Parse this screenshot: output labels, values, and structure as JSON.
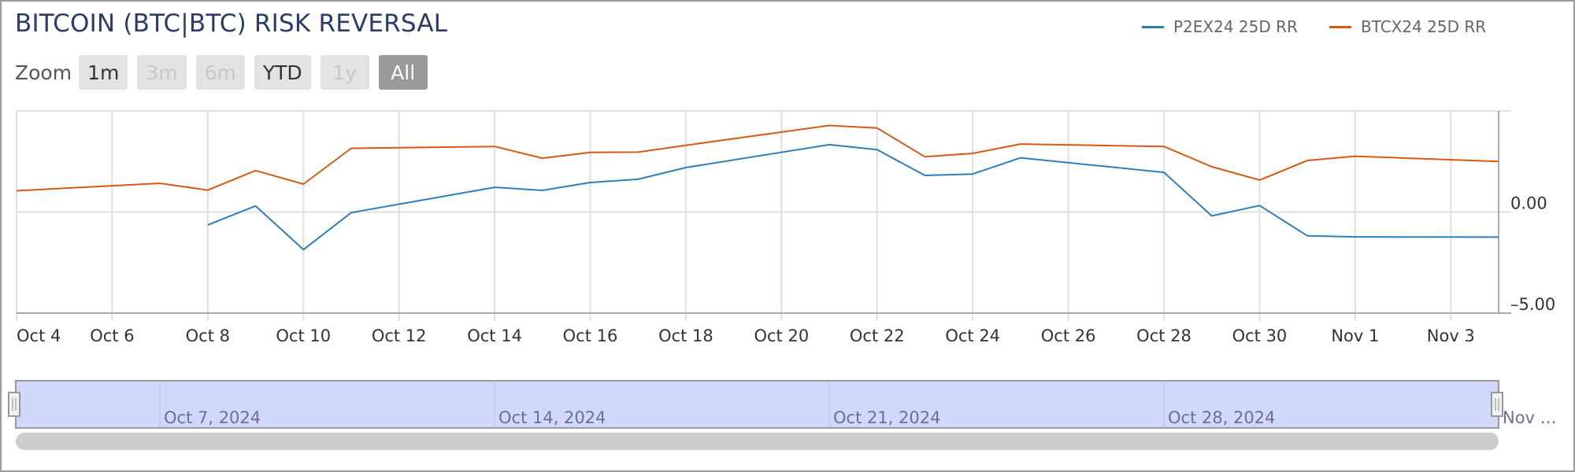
{
  "title": "BITCOIN (BTC|BTC) RISK REVERSAL",
  "range_selector": {
    "label": "Zoom",
    "buttons": [
      {
        "label": "1m",
        "state": "enabled"
      },
      {
        "label": "3m",
        "state": "disabled"
      },
      {
        "label": "6m",
        "state": "disabled"
      },
      {
        "label": "YTD",
        "state": "enabled"
      },
      {
        "label": "1y",
        "state": "disabled"
      },
      {
        "label": "All",
        "state": "active"
      }
    ]
  },
  "colors": {
    "series_blue": "#2f7ebc",
    "series_orange": "#d55a12",
    "title": "#2b3b6b",
    "navigator_fill": "#d2d8fb",
    "scrollbar": "#cccccc"
  },
  "navigator": {
    "labels": [
      "Oct 7, 2024",
      "Oct 14, 2024",
      "Oct 21, 2024",
      "Oct 28, 2024",
      "Nov …"
    ],
    "selected_range": [
      "Oct 4, 2024",
      "Nov 4, 2024"
    ]
  },
  "chart_data": {
    "type": "line",
    "title": "BITCOIN (BTC|BTC) RISK REVERSAL",
    "xlabel": "",
    "ylabel": "",
    "x_range": [
      "2024-10-04",
      "2024-11-04"
    ],
    "ylim": [
      -5,
      5
    ],
    "y_ticks": [
      {
        "value": 0,
        "label": "0.00"
      },
      {
        "value": -5,
        "label": "-5.00"
      }
    ],
    "x_ticks": [
      {
        "date": "2024-10-04",
        "label": "Oct 4"
      },
      {
        "date": "2024-10-06",
        "label": "Oct 6"
      },
      {
        "date": "2024-10-08",
        "label": "Oct 8"
      },
      {
        "date": "2024-10-10",
        "label": "Oct 10"
      },
      {
        "date": "2024-10-12",
        "label": "Oct 12"
      },
      {
        "date": "2024-10-14",
        "label": "Oct 14"
      },
      {
        "date": "2024-10-16",
        "label": "Oct 16"
      },
      {
        "date": "2024-10-18",
        "label": "Oct 18"
      },
      {
        "date": "2024-10-20",
        "label": "Oct 20"
      },
      {
        "date": "2024-10-22",
        "label": "Oct 22"
      },
      {
        "date": "2024-10-24",
        "label": "Oct 24"
      },
      {
        "date": "2024-10-26",
        "label": "Oct 26"
      },
      {
        "date": "2024-10-28",
        "label": "Oct 28"
      },
      {
        "date": "2024-10-30",
        "label": "Oct 30"
      },
      {
        "date": "2024-11-01",
        "label": "Nov 1"
      },
      {
        "date": "2024-11-03",
        "label": "Nov 3"
      }
    ],
    "grid": true,
    "legend": "top-right",
    "series": [
      {
        "name": "P2EX24 25D RR",
        "color": "#2f7ebc",
        "points": [
          {
            "x": "2024-10-08",
            "y": -0.64
          },
          {
            "x": "2024-10-09",
            "y": 0.3
          },
          {
            "x": "2024-10-10",
            "y": -1.86
          },
          {
            "x": "2024-10-11",
            "y": -0.03
          },
          {
            "x": "2024-10-14",
            "y": 1.22
          },
          {
            "x": "2024-10-15",
            "y": 1.07
          },
          {
            "x": "2024-10-16",
            "y": 1.46
          },
          {
            "x": "2024-10-17",
            "y": 1.62
          },
          {
            "x": "2024-10-18",
            "y": 2.2
          },
          {
            "x": "2024-10-21",
            "y": 3.33
          },
          {
            "x": "2024-10-22",
            "y": 3.08
          },
          {
            "x": "2024-10-23",
            "y": 1.81
          },
          {
            "x": "2024-10-24",
            "y": 1.88
          },
          {
            "x": "2024-10-25",
            "y": 2.68
          },
          {
            "x": "2024-10-28",
            "y": 1.96
          },
          {
            "x": "2024-10-29",
            "y": -0.19
          },
          {
            "x": "2024-10-30",
            "y": 0.32
          },
          {
            "x": "2024-10-31",
            "y": -1.18
          },
          {
            "x": "2024-11-01",
            "y": -1.23
          },
          {
            "x": "2024-11-04",
            "y": -1.24
          }
        ]
      },
      {
        "name": "BTCX24 25D RR",
        "color": "#d55a12",
        "points": [
          {
            "x": "2024-10-04",
            "y": 1.05
          },
          {
            "x": "2024-10-07",
            "y": 1.42
          },
          {
            "x": "2024-10-08",
            "y": 1.08
          },
          {
            "x": "2024-10-09",
            "y": 2.05
          },
          {
            "x": "2024-10-10",
            "y": 1.38
          },
          {
            "x": "2024-10-11",
            "y": 3.15
          },
          {
            "x": "2024-10-14",
            "y": 3.24
          },
          {
            "x": "2024-10-15",
            "y": 2.66
          },
          {
            "x": "2024-10-16",
            "y": 2.95
          },
          {
            "x": "2024-10-17",
            "y": 2.96
          },
          {
            "x": "2024-10-18",
            "y": 3.3
          },
          {
            "x": "2024-10-21",
            "y": 4.28
          },
          {
            "x": "2024-10-22",
            "y": 4.15
          },
          {
            "x": "2024-10-23",
            "y": 2.73
          },
          {
            "x": "2024-10-24",
            "y": 2.9
          },
          {
            "x": "2024-10-25",
            "y": 3.36
          },
          {
            "x": "2024-10-28",
            "y": 3.24
          },
          {
            "x": "2024-10-29",
            "y": 2.24
          },
          {
            "x": "2024-10-30",
            "y": 1.58
          },
          {
            "x": "2024-10-31",
            "y": 2.55
          },
          {
            "x": "2024-11-01",
            "y": 2.76
          },
          {
            "x": "2024-11-04",
            "y": 2.5
          }
        ]
      }
    ]
  }
}
